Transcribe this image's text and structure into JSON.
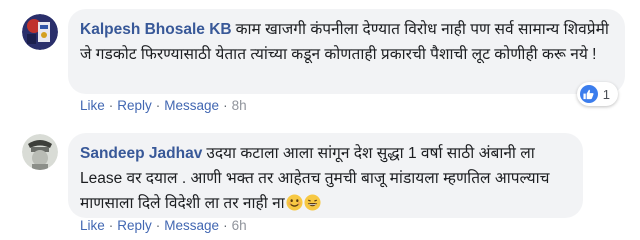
{
  "comments": [
    {
      "author": "Kalpesh Bhosale KB",
      "text": "काम खाजगी कंपनीला देण्यात विरोध नाही पण सर्व सामान्य शिवप्रेमी जे गडकोट फिरण्यासाठी येतात त्यांच्या कडून कोणताही प्रकारची पैशाची लूट कोणीही करू नये !",
      "actions": {
        "like": "Like",
        "reply": "Reply",
        "message": "Message",
        "time": "8h"
      },
      "reaction": {
        "icon": "thumbs-up-icon",
        "count": "1"
      }
    },
    {
      "author": "Sandeep Jadhav",
      "text": "उदया कटाला आला सांगून देश सुद्धा 1 वर्षा साठी अंबानी ला Lease वर दयाल . आणी भक्त तर आहेतच तुमची बाजू मांडायला म्हणतिल आपल्याच माणसाला दिले विदेशी ला तर नाही ना",
      "emojis": [
        "smiling-face-icon",
        "grinning-face-icon"
      ],
      "actions": {
        "like": "Like",
        "reply": "Reply",
        "message": "Message",
        "time": "6h"
      }
    }
  ],
  "colors": {
    "author": "#385898",
    "link": "#4267b2",
    "bubble": "#f2f3f5",
    "like_blue": "#3b7ded"
  }
}
